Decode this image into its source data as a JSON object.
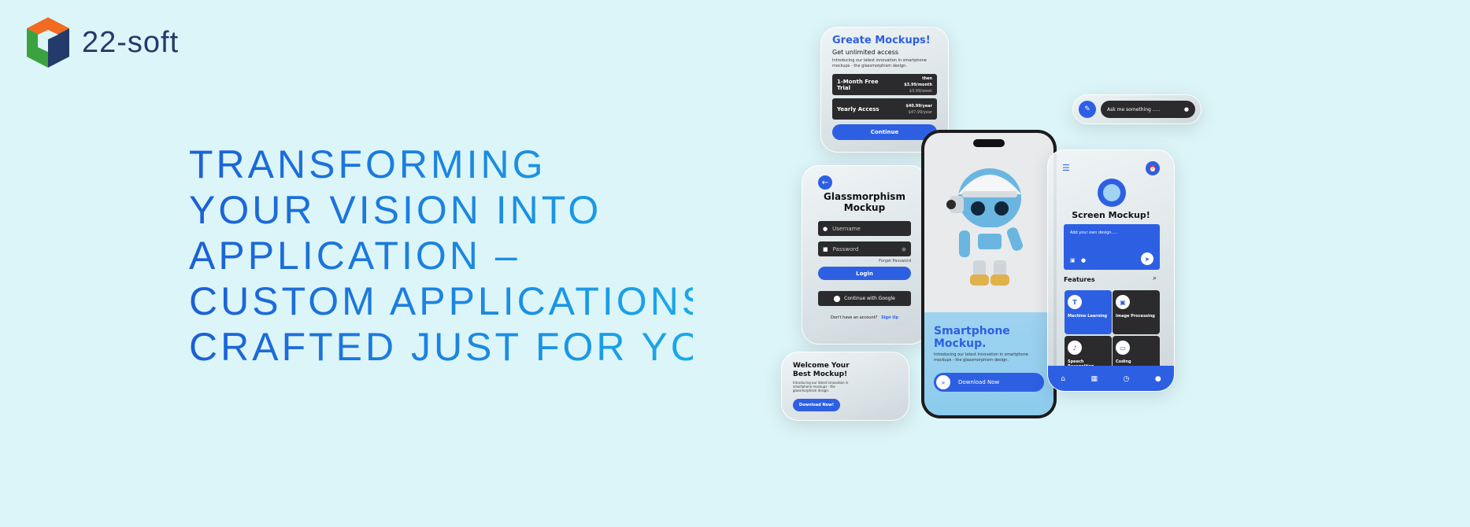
{
  "brand": {
    "name": "22-soft",
    "colors": {
      "orange": "#f26b21",
      "green": "#3aa33f",
      "navy": "#243a6a"
    }
  },
  "headline": [
    "TRANSFORMING",
    "YOUR VISION INTO",
    "APPLICATION –",
    "CUSTOM APPLICATIONS",
    "CRAFTED JUST FOR YOU"
  ],
  "pricing_card": {
    "title": "Greate Mockups!",
    "subtitle": "Get unlimited access",
    "desc": "Introducing our latest innovation in smartphone mockups - the glassmorphism design.",
    "plans": [
      {
        "label": "1-Month Free Trial",
        "price": "then $3.99/month",
        "sub": "$3.99/week"
      },
      {
        "label": "Yearly Access",
        "price": "$40.99/year",
        "sub": "$47.99/year"
      }
    ],
    "button": "Continue"
  },
  "login_card": {
    "title1": "Glassmorphism",
    "title2": "Mockup",
    "username_placeholder": "Username",
    "password_placeholder": "Password",
    "forgot": "Forget Password",
    "login": "Login",
    "google": "Continue with Google",
    "no_account": "Don't have an account?",
    "signup": "Sign Up"
  },
  "welcome_card": {
    "title1": "Welcome Your",
    "title2": "Best Mockup!",
    "desc": "Introducing our latest innovation in smartphone mockups - the glassmorphism design.",
    "button": "Download Now!"
  },
  "phone": {
    "title1": "Smartphone",
    "title2": "Mockup.",
    "desc": "Introducing our latest innovation in smartphone mockups - the glassmorphism design.",
    "button": "Download Now"
  },
  "chat_bar": {
    "placeholder": "Ask me something ....."
  },
  "screen_card": {
    "title": "Screen Mockup!",
    "input_placeholder": "Add your own design.....",
    "features_label": "Features",
    "features": [
      "Machine Learning",
      "Image Processing",
      "Speech Recognition",
      "Coding"
    ]
  }
}
